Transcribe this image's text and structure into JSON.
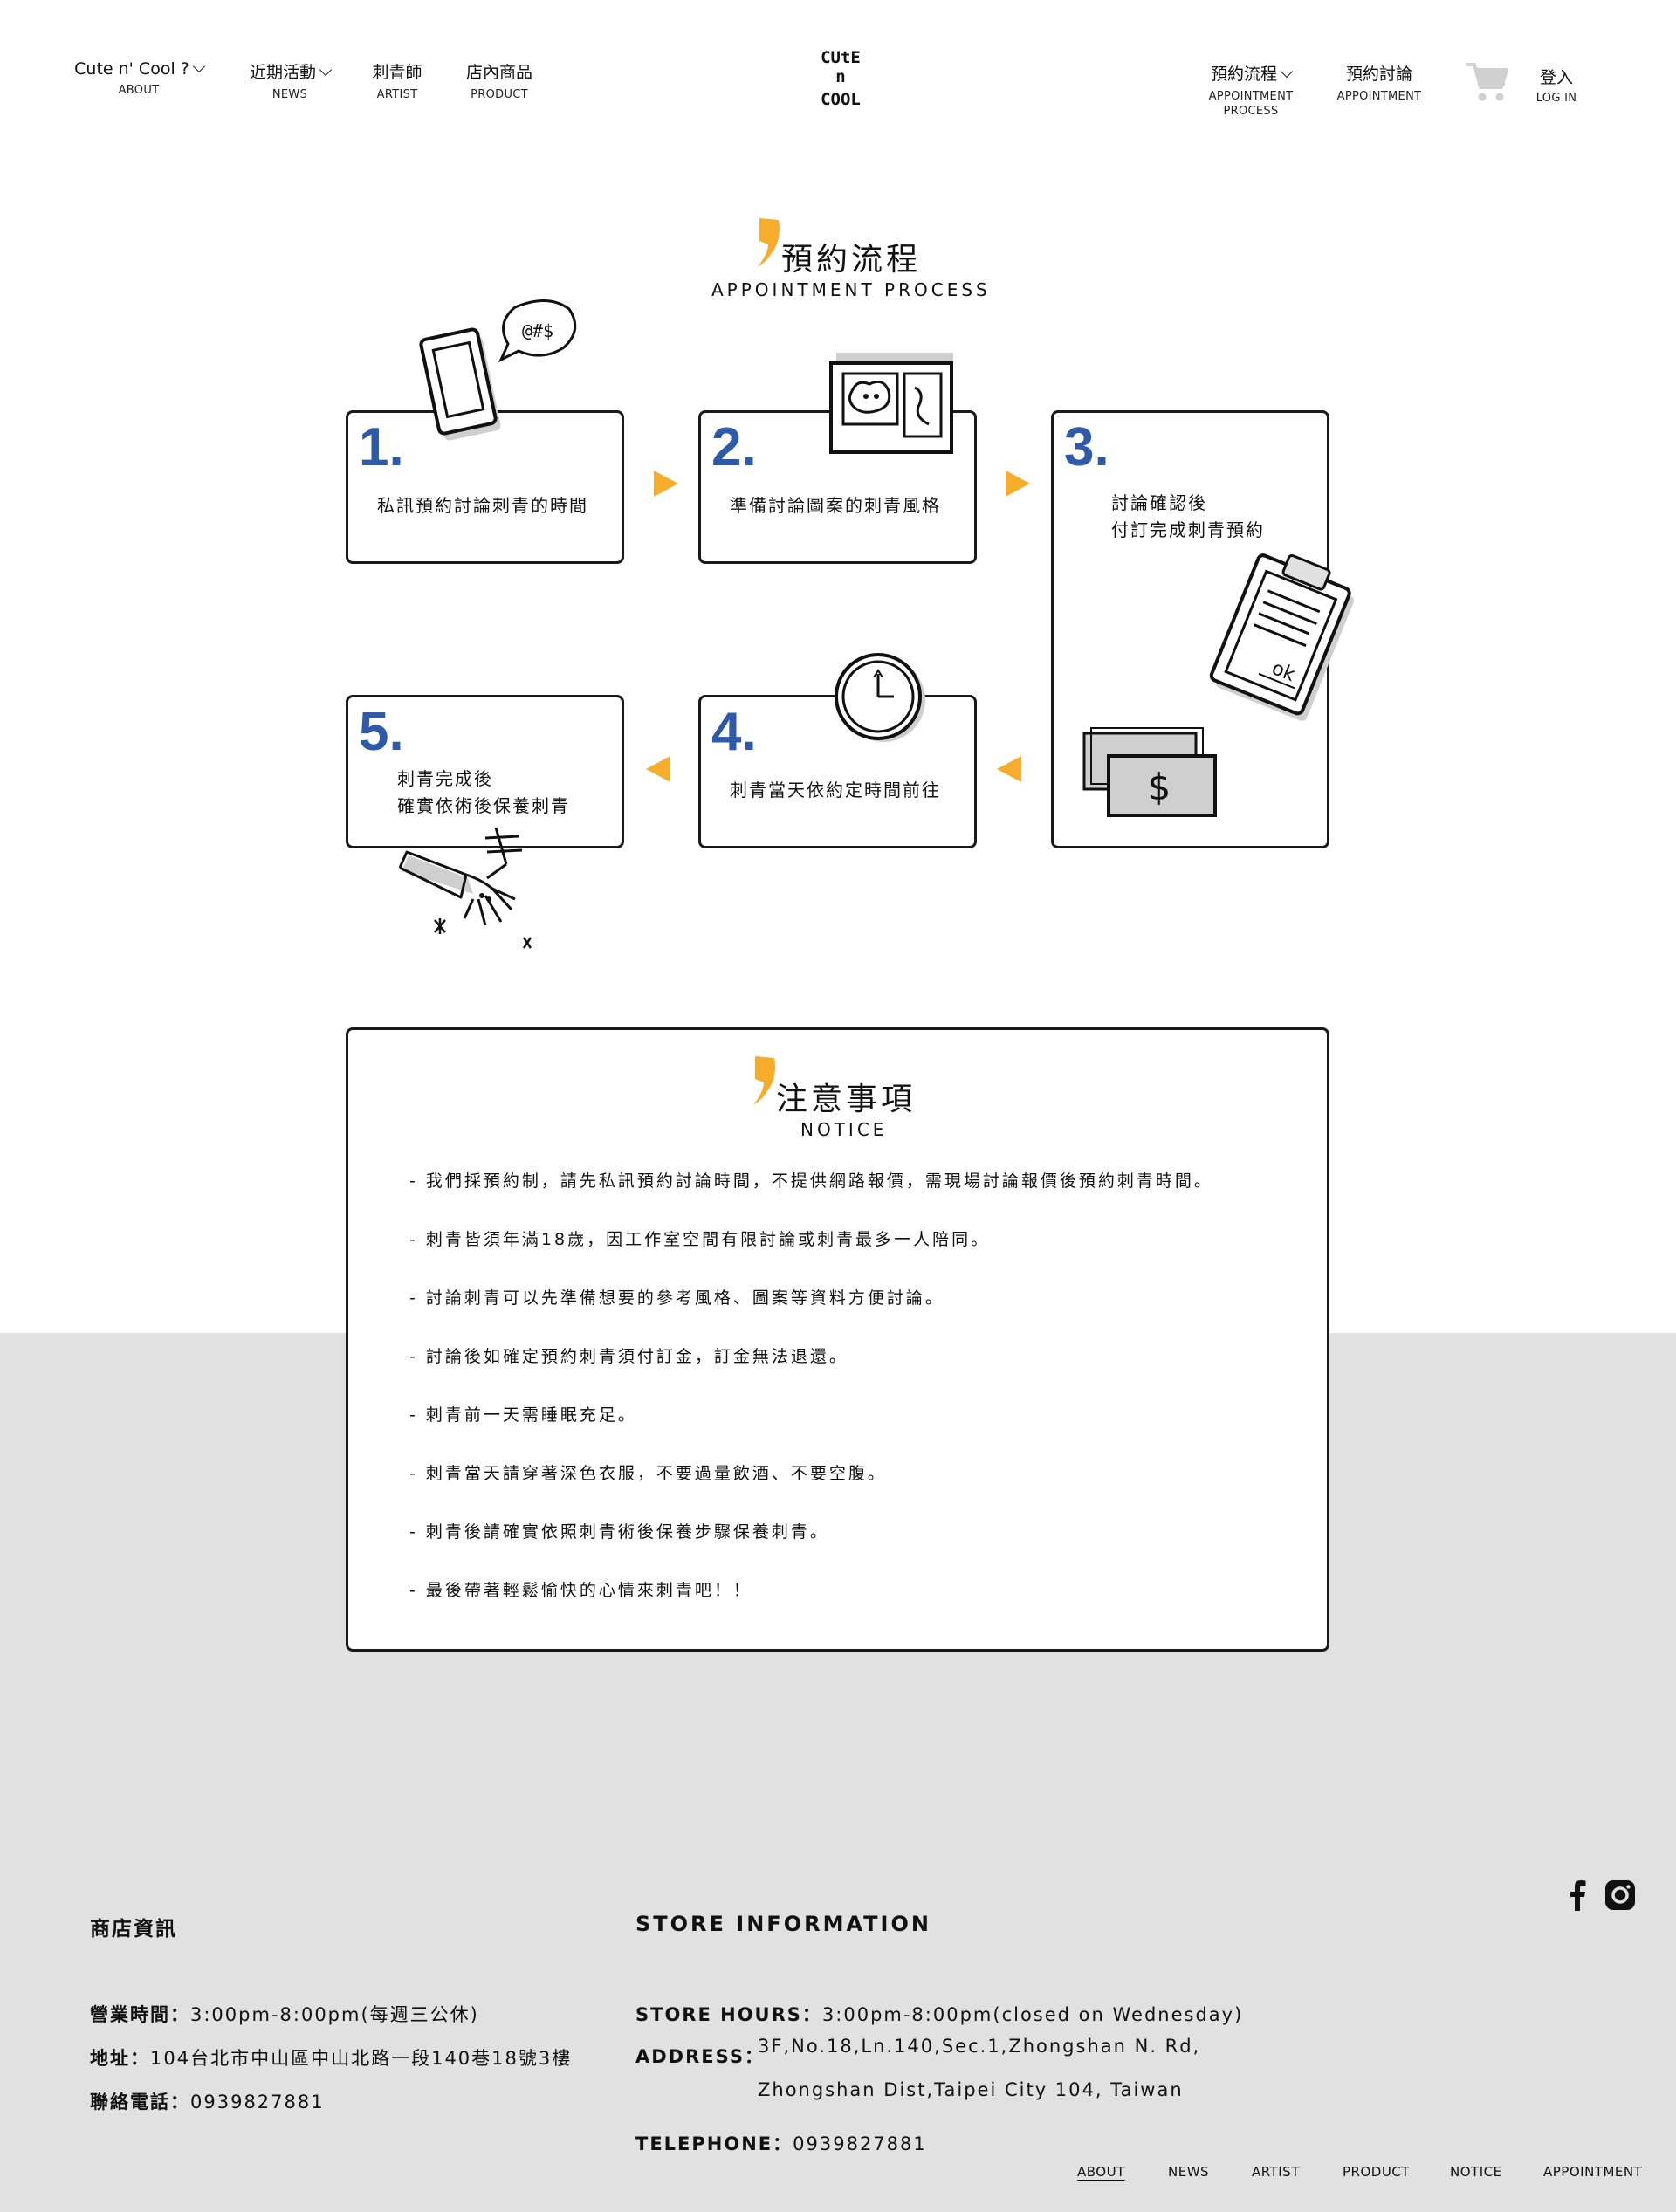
{
  "header": {
    "left_nav": [
      {
        "zh": "Cute n' Cool ?",
        "en": "ABOUT"
      },
      {
        "zh": "近期活動",
        "en": "NEWS"
      },
      {
        "zh": "刺青師",
        "en": "ARTIST"
      },
      {
        "zh": "店內商品",
        "en": "PRODUCT"
      }
    ],
    "logo": {
      "line1": "CUtE",
      "line2": "n",
      "line3": "COOL"
    },
    "right_nav": [
      {
        "zh": "預約流程",
        "en": "APPOINTMENT PROCESS"
      },
      {
        "zh": "預約討論",
        "en": "APPOINTMENT"
      }
    ],
    "cart_icon": "cart-icon",
    "login": {
      "zh": "登入",
      "en": "LOG IN"
    }
  },
  "process": {
    "title_zh": "預約流程",
    "title_en": "APPOINTMENT PROCESS",
    "steps": [
      {
        "num": "1.",
        "text": "私訊預約討論刺青的時間"
      },
      {
        "num": "2.",
        "text": "準備討論圖案的刺青風格"
      },
      {
        "num": "3.",
        "line1": "討論確認後",
        "line2": "付訂完成刺青預約"
      },
      {
        "num": "4.",
        "text": "刺青當天依約定時間前往"
      },
      {
        "num": "5.",
        "line1": "刺青完成後",
        "line2": "確實依術後保養刺青"
      }
    ],
    "bubble_text": "@#$",
    "ok_text": "ok",
    "dollar_text": "$"
  },
  "notice": {
    "title_zh": "注意事項",
    "title_en": "NOTICE",
    "items": [
      "- 我們採預約制，請先私訊預約討論時間，不提供網路報價，需現場討論報價後預約刺青時間。",
      "- 刺青皆須年滿18歲，因工作室空間有限討論或刺青最多一人陪同。",
      "- 討論刺青可以先準備想要的參考風格、圖案等資料方便討論。",
      "- 討論後如確定預約刺青須付訂金，訂金無法退還。",
      "- 刺青前一天需睡眠充足。",
      "- 刺青當天請穿著深色衣服，不要過量飲酒、不要空腹。",
      "- 刺青後請確實依照刺青術後保養步驟保養刺青。",
      "- 最後帶著輕鬆愉快的心情來刺青吧！！"
    ]
  },
  "footer": {
    "zh": {
      "heading": "商店資訊",
      "hours_label": "營業時間：",
      "hours": "3:00pm-8:00pm(每週三公休)",
      "address_label": "地址：",
      "address": "104台北市中山區中山北路一段140巷18號3樓",
      "phone_label": "聯絡電話：",
      "phone": "0939827881"
    },
    "en": {
      "heading": "STORE INFORMATION",
      "hours_label": "STORE HOURS：",
      "hours": "3:00pm-8:00pm(closed on Wednesday)",
      "address_label": "ADDRESS：",
      "address_line1": "3F,No.18,Ln.140,Sec.1,Zhongshan N. Rd,",
      "address_line2": "Zhongshan Dist,Taipei City 104, Taiwan",
      "phone_label": "TELEPHONE：",
      "phone": "0939827881"
    },
    "nav": [
      "ABOUT",
      "NEWS",
      "ARTIST",
      "PRODUCT",
      "NOTICE",
      "APPOINTMENT"
    ],
    "social": [
      "facebook-icon",
      "instagram-icon"
    ]
  },
  "colors": {
    "accent": "#f6ad2c",
    "step_number": "#2f5aa8",
    "footer_bg": "#e1e1e1"
  }
}
